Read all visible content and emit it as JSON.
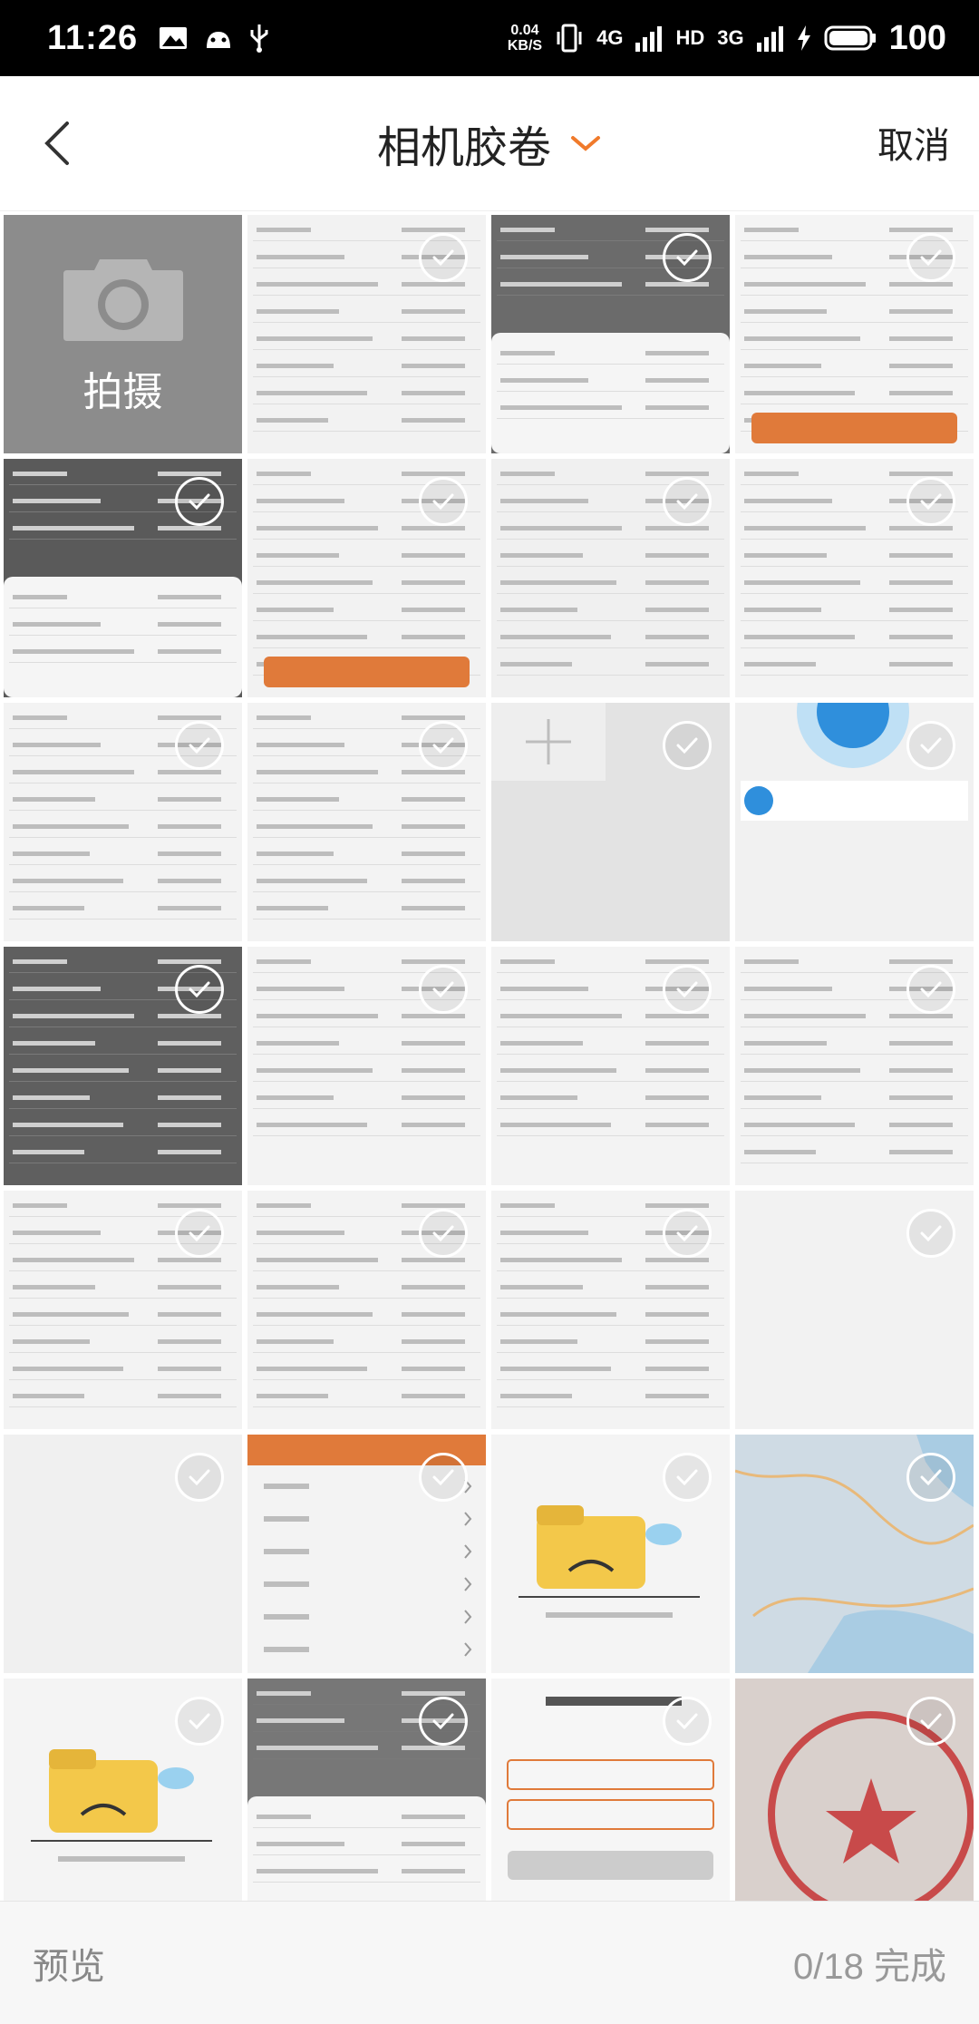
{
  "status_bar": {
    "time": "11:26",
    "net_speed_value": "0.04",
    "net_speed_unit": "KB/S",
    "net1": "4G",
    "hd": "HD",
    "net2": "3G",
    "battery": "100",
    "icons": [
      "image-icon",
      "android-icon",
      "usb-icon",
      "vibrate-icon",
      "signal-icon",
      "battery-charging-icon"
    ]
  },
  "header": {
    "back_icon": "chevron-left-icon",
    "title": "相机胶卷",
    "title_dropdown_icon": "chevron-down-icon",
    "cancel_label": "取消",
    "accent_color": "#f07a2b"
  },
  "camera_tile": {
    "icon": "camera-icon",
    "label": "拍摄"
  },
  "photos": [
    {
      "id": "p1"
    },
    {
      "id": "p2"
    },
    {
      "id": "p3"
    },
    {
      "id": "p4"
    },
    {
      "id": "p5"
    },
    {
      "id": "p6"
    },
    {
      "id": "p7"
    },
    {
      "id": "p8"
    },
    {
      "id": "p9"
    },
    {
      "id": "p10"
    },
    {
      "id": "p11"
    },
    {
      "id": "p12"
    },
    {
      "id": "p13"
    },
    {
      "id": "p14"
    },
    {
      "id": "p15"
    },
    {
      "id": "p16"
    },
    {
      "id": "p17"
    },
    {
      "id": "p18"
    },
    {
      "id": "p19"
    },
    {
      "id": "p20"
    },
    {
      "id": "p21"
    },
    {
      "id": "p22"
    },
    {
      "id": "p23"
    },
    {
      "id": "p24"
    },
    {
      "id": "p25"
    },
    {
      "id": "p26"
    },
    {
      "id": "p27"
    }
  ],
  "bottom_bar": {
    "preview_label": "预览",
    "done_label": "0/18 完成"
  }
}
